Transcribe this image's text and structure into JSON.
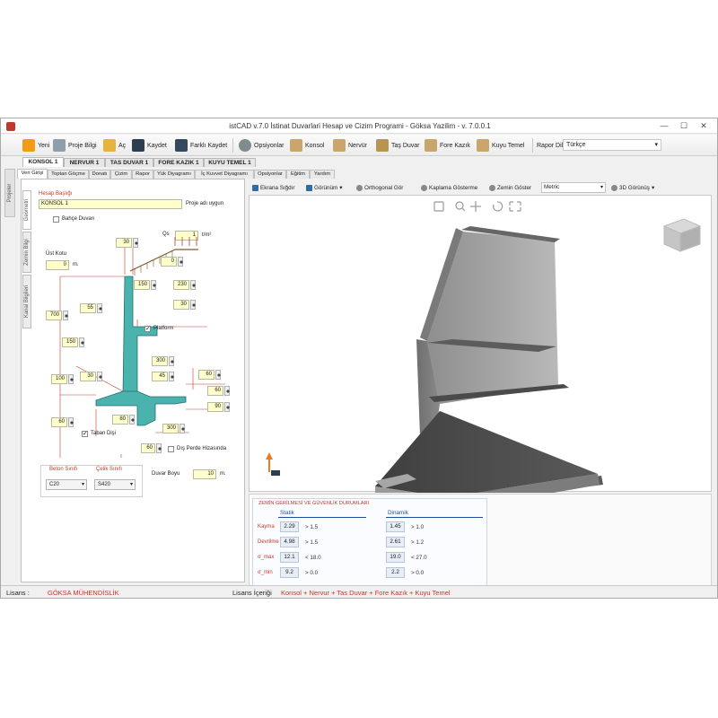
{
  "window": {
    "title": "istCAD v.7.0 İstinat Duvarlari Hesap ve Cizim Programi - Göksa Yazilim - v. 7.0.0.1"
  },
  "toolbar": {
    "new": "Yeni",
    "project_info": "Proje Bilgi",
    "open": "Aç",
    "save": "Kaydet",
    "save_as": "Farklı Kaydet",
    "options": "Opsiyonlar",
    "konsol": "Konsol",
    "nervur": "Nervür",
    "tas_duvar": "Taş Duvar",
    "fore_kazik": "Fore Kazık",
    "kuyu_temel": "Kuyu Temel",
    "report_lang_label": "Rapor Dili",
    "report_lang": "Türkçe"
  },
  "project_tabs": [
    "KONSOL 1",
    "NERVUR 1",
    "TAS DUVAR 1",
    "FORE KAZIK 1",
    "KUYU TEMEL 1"
  ],
  "left_strip": {
    "label": "Projeler"
  },
  "sub_tabs": [
    "Veri Girişi",
    "Toptan Göçme",
    "Donatı",
    "Çizim",
    "Rapor",
    "Yük Diyagramı",
    "İç Kuvvet Diyagramı",
    "Opsiyonlar",
    "Eğitim",
    "Yardım"
  ],
  "left_vtabs": [
    "Geometri",
    "Zemin Bilgi",
    "Kanal Bilgileri"
  ],
  "form": {
    "title_label": "Hesap Başlığı",
    "title_value": "KONSOL 1",
    "title_hint": "Proje adı uygun",
    "garden_wall": "Bahçe Duvarı",
    "top_level_label": "Üst Kotu",
    "top_level_value": "0",
    "top_level_unit": "m.",
    "qs_label": "Qs",
    "qs_value": "1",
    "qs_unit": "t/m²",
    "platform": "Platform",
    "toe_tooth": "Taban Dişi",
    "outer_face_level": "Dış Perde Hizasında",
    "concrete_label": "Beton Sınıfı",
    "concrete_value": "C20",
    "steel_label": "Çelik Sınıfı",
    "steel_value": "S420",
    "wall_length_label": "Duvar Boyu",
    "wall_length_value": "10",
    "wall_length_unit": "m."
  },
  "dims": {
    "d30_top": "30",
    "d0": "0",
    "d150": "150",
    "d230": "230",
    "d55": "55",
    "d30_mid": "30",
    "d700": "700",
    "d150_left": "150",
    "d300": "300",
    "d30_low": "30",
    "d45": "45",
    "d60_r1": "60",
    "d100": "100",
    "d60_r2": "60",
    "d90": "90",
    "d60_left": "60",
    "d80": "80",
    "d300_low": "300",
    "d60_bottom": "60"
  },
  "view": {
    "fit": "Ekrana Sığdır",
    "view_menu": "Görünüm",
    "ortho": "Orthogonal Gör",
    "coating": "Kaplama Gösterme",
    "soil": "Zemin Göster",
    "units": "Metric",
    "view3d": "3D Görünüş"
  },
  "results": {
    "heading": "ZEMİN GERİLMESİ VE GÜVENLİK DURUMLARI",
    "static": "Statik",
    "dynamic": "Dinamik",
    "rows": [
      {
        "label": "Kayma",
        "s_val": "2.29",
        "s_crit": "> 1.5",
        "d_val": "1.45",
        "d_crit": "> 1.0"
      },
      {
        "label": "Devrilme",
        "s_val": "4.98",
        "s_crit": "> 1.5",
        "d_val": "2.61",
        "d_crit": "> 1.2"
      },
      {
        "label": "σ_max",
        "s_val": "12.1",
        "s_crit": "< 18.0",
        "d_val": "19.0",
        "d_crit": "< 27.0"
      },
      {
        "label": "σ_min",
        "s_val": "9.2",
        "s_crit": "> 0.0",
        "d_val": "2.2",
        "d_crit": "> 0.0"
      }
    ]
  },
  "status": {
    "license_label": "Lisans :",
    "license_owner": "GÖKSA MÜHENDİSLİK",
    "content_label": "Lisans İçeriği",
    "content_value": "Konsol + Nervur + Tas Duvar + Fore Kazık + Kuyu Temel"
  },
  "colors": {
    "accent_red": "#c0392b",
    "section_fill": "#4bb3ae",
    "field_yellow": "#ffffcc"
  }
}
